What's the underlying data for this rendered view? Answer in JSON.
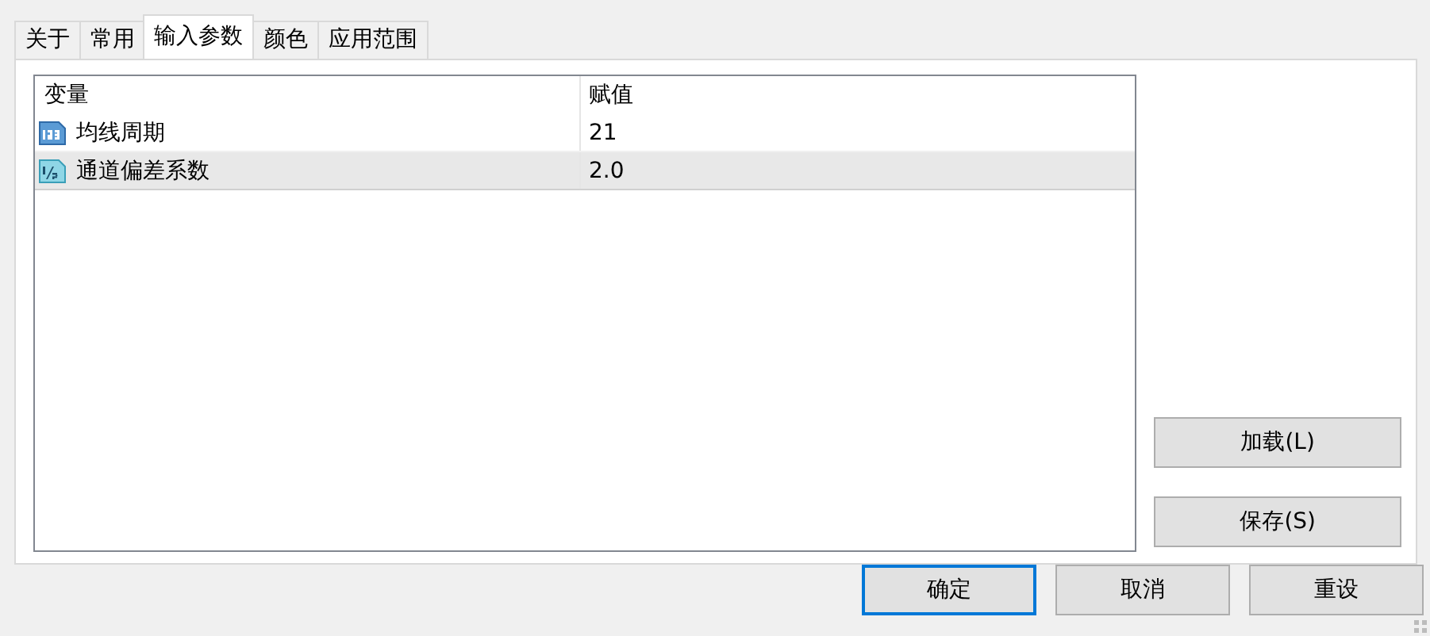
{
  "tabs": [
    {
      "label": "关于",
      "selected": false
    },
    {
      "label": "常用",
      "selected": false
    },
    {
      "label": "输入参数",
      "selected": true
    },
    {
      "label": "颜色",
      "selected": false
    },
    {
      "label": "应用范围",
      "selected": false
    }
  ],
  "table": {
    "columns": [
      "变量",
      "赋值"
    ],
    "rows": [
      {
        "kind": "integer",
        "name": "均线周期",
        "value": "21",
        "selected": false
      },
      {
        "kind": "double",
        "name": "通道偏差系数",
        "value": "2.0",
        "selected": true
      }
    ]
  },
  "side_buttons": [
    "加载(L)",
    "保存(S)"
  ],
  "buttons": [
    {
      "label": "确定",
      "default": true
    },
    {
      "label": "取消",
      "default": false
    },
    {
      "label": "重设",
      "default": false
    }
  ]
}
